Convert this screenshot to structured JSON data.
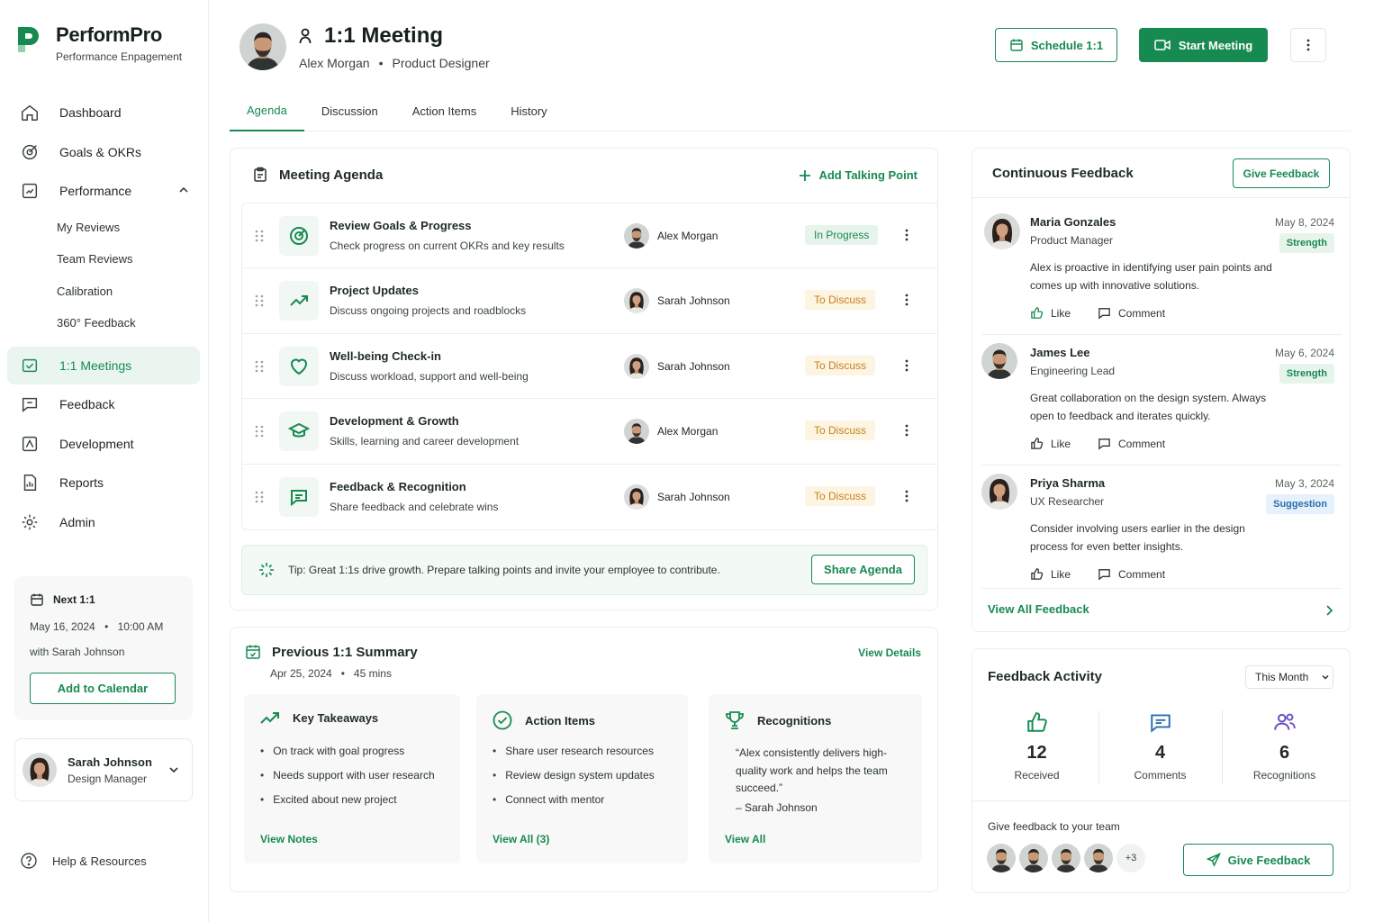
{
  "brand": {
    "name": "PerformPro",
    "tagline": "Performance Enpagement"
  },
  "nav": {
    "dashboard": "Dashboard",
    "goals": "Goals & OKRs",
    "performance": "Performance",
    "sub": [
      "My Reviews",
      "Team Reviews",
      "Calibration",
      "360° Feedback"
    ],
    "meetings": "1:1 Meetings",
    "feedback": "Feedback",
    "development": "Development",
    "reports": "Reports",
    "admin": "Admin"
  },
  "next": {
    "title": "Next 1:1",
    "date": "May 16, 2024",
    "time": "10:00 AM",
    "with": "with Sarah Johnson",
    "button": "Add to Calendar"
  },
  "user": {
    "name": "Sarah Johnson",
    "role": "Design Manager"
  },
  "help": "Help & Resources",
  "header": {
    "title": "1:1 Meeting",
    "person": "Alex Morgan",
    "role": "Product Designer",
    "schedule": "Schedule 1:1",
    "start": "Start Meeting"
  },
  "tabs": [
    "Agenda",
    "Discussion",
    "Action Items",
    "History"
  ],
  "agenda": {
    "title": "Meeting Agenda",
    "add": "Add Talking Point",
    "items": [
      {
        "title": "Review Goals & Progress",
        "desc": "Check progress on current OKRs and key results",
        "owner": "Alex Morgan",
        "status": "In Progress"
      },
      {
        "title": "Project Updates",
        "desc": "Discuss ongoing projects and roadblocks",
        "owner": "Sarah Johnson",
        "status": "To Discuss"
      },
      {
        "title": "Well-being Check-in",
        "desc": "Discuss workload, support and well-being",
        "owner": "Sarah Johnson",
        "status": "To Discuss"
      },
      {
        "title": "Development & Growth",
        "desc": "Skills, learning and career development",
        "owner": "Alex Morgan",
        "status": "To Discuss"
      },
      {
        "title": "Feedback & Recognition",
        "desc": "Share feedback and celebrate wins",
        "owner": "Sarah Johnson",
        "status": "To Discuss"
      }
    ],
    "tip": "Tip: Great 1:1s drive growth. Prepare talking points and invite your employee to contribute.",
    "share": "Share Agenda"
  },
  "previous": {
    "title": "Previous 1:1 Summary",
    "date": "Apr 25, 2024",
    "duration": "45 mins",
    "details": "View Details",
    "takeaways": {
      "title": "Key Takeaways",
      "items": [
        "On track with goal progress",
        "Needs support with user research",
        "Excited about new project"
      ],
      "link": "View Notes"
    },
    "actions": {
      "title": "Action Items",
      "items": [
        "Share user research resources",
        "Review design system updates",
        "Connect with mentor"
      ],
      "link": "View All (3)"
    },
    "recognitions": {
      "title": "Recognitions",
      "quote": "“Alex consistently delivers high-quality work and helps the team succeed.”",
      "by": "– Sarah Johnson",
      "link": "View All"
    }
  },
  "feedback": {
    "title": "Continuous Feedback",
    "give": "Give Feedback",
    "like": "Like",
    "comment": "Comment",
    "view_all": "View All Feedback",
    "items": [
      {
        "name": "Maria Gonzales",
        "role": "Product Manager",
        "date": "May 8, 2024",
        "tag": "Strength",
        "text": "Alex is proactive in identifying user pain points and comes up with innovative solutions."
      },
      {
        "name": "James Lee",
        "role": "Engineering Lead",
        "date": "May 6, 2024",
        "tag": "Strength",
        "text": "Great collaboration on the design system. Always open to feedback and iterates quickly."
      },
      {
        "name": "Priya Sharma",
        "role": "UX Researcher",
        "date": "May 3, 2024",
        "tag": "Suggestion",
        "text": "Consider involving users earlier in the design process for even better insights."
      }
    ]
  },
  "activity": {
    "title": "Feedback Activity",
    "period": "This Month",
    "stats": [
      {
        "value": "12",
        "label": "Received"
      },
      {
        "value": "4",
        "label": "Comments"
      },
      {
        "value": "6",
        "label": "Recognitions"
      }
    ],
    "team_label": "Give feedback to your team",
    "more": "+3",
    "give": "Give Feedback"
  },
  "colors": {
    "accent": "#178a52",
    "warn": "#c4821c",
    "info": "#2a6fb0"
  }
}
